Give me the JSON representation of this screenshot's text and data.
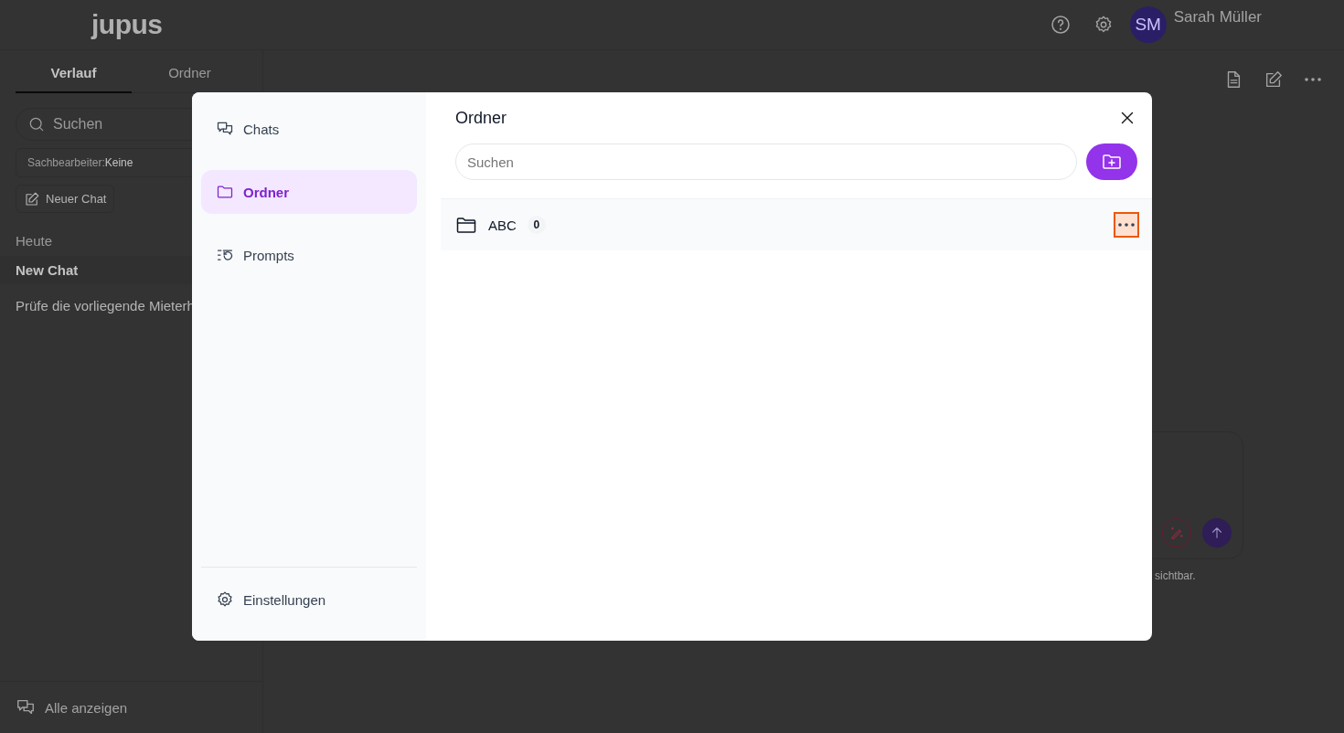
{
  "header": {
    "logo": "jupus",
    "user": {
      "initials": "SM",
      "name": "Sarah Müller"
    }
  },
  "sidebar": {
    "tabs": [
      {
        "label": "Verlauf",
        "selected": true
      },
      {
        "label": "Ordner",
        "selected": false
      }
    ],
    "search": {
      "placeholder": "Suchen"
    },
    "filter": {
      "label": "Sachbearbeiter:",
      "value": "Keine"
    },
    "new_chat": "Neuer Chat",
    "groups": [
      {
        "title": "Heute",
        "items": [
          {
            "label": "New Chat",
            "selected": true
          },
          {
            "label": "Prüfe die vorliegende Mieterh",
            "selected": false
          }
        ]
      }
    ],
    "show_all": "Alle anzeigen"
  },
  "composer": {
    "note": "sichtbar."
  },
  "dialog": {
    "nav": [
      {
        "label": "Chats",
        "selected": false
      },
      {
        "label": "Ordner",
        "selected": true
      },
      {
        "label": "Prompts",
        "selected": false
      }
    ],
    "settings": "Einstellungen",
    "title": "Ordner",
    "search": {
      "placeholder": "Suchen"
    },
    "folders": [
      {
        "name": "ABC",
        "count": "0",
        "focused": true
      }
    ]
  }
}
